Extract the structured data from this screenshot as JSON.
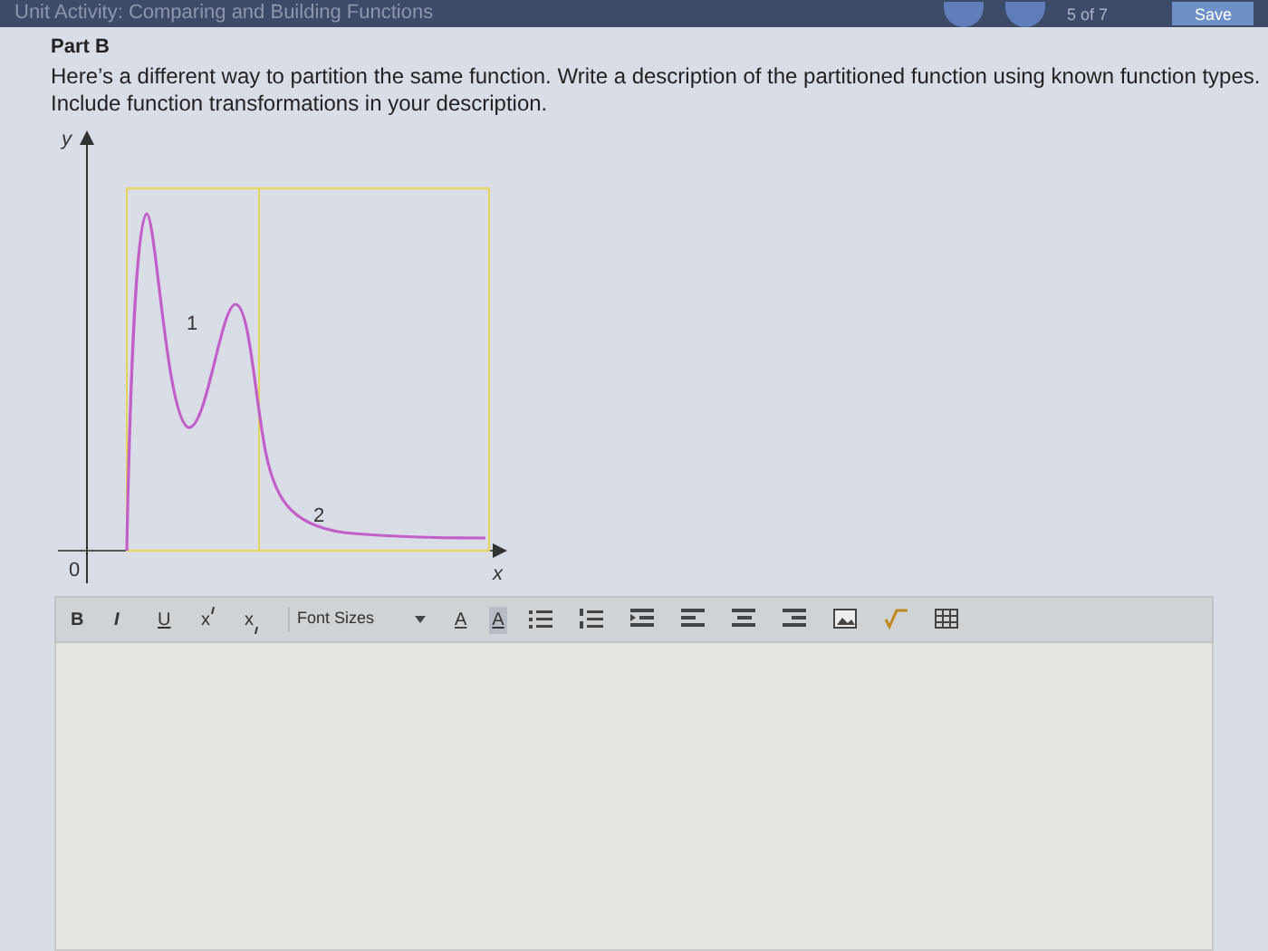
{
  "header": {
    "title": "Unit Activity: Comparing and Building Functions",
    "page_counter": "5 of 7",
    "save_button": "Save"
  },
  "part": {
    "heading": "Part B",
    "prompt": "Here’s a different way to partition the same function. Write a description of the partitioned function using known function types. Include function transformations in your description."
  },
  "graph": {
    "y_label": "y",
    "x_label": "x",
    "origin_label": "0",
    "region_labels": [
      "1",
      "2"
    ]
  },
  "toolbar": {
    "format_buttons": [
      {
        "label": "B",
        "kind": "bold"
      },
      {
        "label": "I",
        "kind": "italic"
      },
      {
        "label": "U",
        "kind": "underline"
      },
      {
        "label": "x",
        "kind": "superscript"
      },
      {
        "label": "x",
        "kind": "subscript"
      }
    ],
    "font_size_select": "Font Sizes",
    "color_buttons": [
      {
        "label": "A",
        "kind": "text-color"
      },
      {
        "label": "A",
        "kind": "highlight"
      }
    ]
  }
}
